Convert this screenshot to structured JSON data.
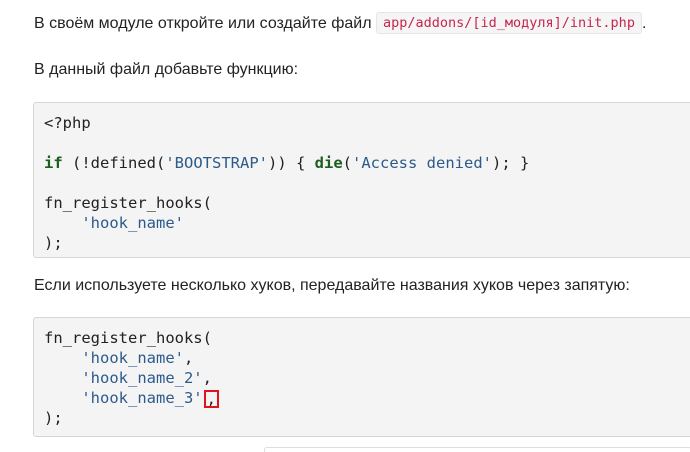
{
  "intro": {
    "text": "В своём модуле откройте или создайте файл",
    "path": "app/addons/[id_модуля]/init.php",
    "end": "."
  },
  "step2": {
    "text": "В данный файл добавьте функцию:"
  },
  "code1": {
    "line1": "<?php",
    "kw_if": "if",
    "cond_open": " (!defined(",
    "bootstrap_str": "'BOOTSTRAP'",
    "cond_close": ")) { ",
    "kw_die": "die",
    "die_open": "(",
    "denied_str": "'Access denied'",
    "die_close": "); }",
    "fn_call": "fn_register_hooks(",
    "indent": "    ",
    "hook_str": "'hook_name'",
    "closing": ");"
  },
  "step3": {
    "text": "Если используете несколько хуков, передавайте названия хуков через запятую:"
  },
  "code2": {
    "fn_call": "fn_register_hooks(",
    "indent": "    ",
    "hook1": "'hook_name'",
    "hook2": "'hook_name_2'",
    "hook3": "'hook_name_3'",
    "comma": ",",
    "closing": ");"
  }
}
